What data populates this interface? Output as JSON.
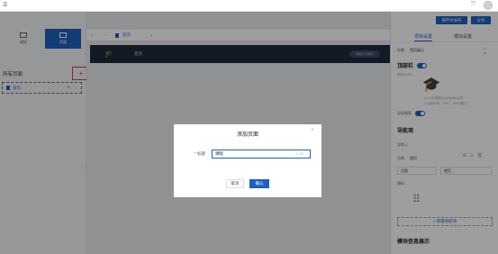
{
  "topbar": {
    "menu_icon": "menu-icon",
    "expand_icon": "fullscreen-icon",
    "avatar_icon": "user-avatar"
  },
  "left": {
    "modes": [
      {
        "label": "模块",
        "icon": "module-icon"
      },
      {
        "label": "页面",
        "icon": "page-icon"
      }
    ],
    "pages_title": "所有页面",
    "add_symbol": "+",
    "pages": [
      {
        "label": "首页"
      }
    ]
  },
  "editor": {
    "tab_label": "首页",
    "header_home": "首页",
    "search_placeholder": "请输入关键字"
  },
  "right": {
    "save_publish": "保存并发布",
    "publish": "分享",
    "tabs": [
      "项目设置",
      "模块设置"
    ],
    "title_label": "标题",
    "title_value": "首页展示",
    "title_count": "4 / 15",
    "topbar_section": "顶部栏",
    "logo_label": "网站LOGO",
    "logo_hint_1": "1.LOGO图片大小为6kb以内",
    "logo_hint_2": "2.支持PNG、JPG、JPEG格式",
    "full_search": "全局搜索",
    "nav_section": "导航项",
    "nav_item": "导航-1",
    "nav_name_label": "名称",
    "nav_name_value": "首页",
    "nav_type": "页面",
    "nav_target": "首页",
    "icon_label": "图标",
    "add_nav": "+ 新增导航项",
    "module_section": "模块信息展示"
  },
  "dialog": {
    "title": "添加页面",
    "required_mark": "*",
    "field_label": "标题",
    "field_value": "课程",
    "field_count": "2 / 15",
    "cancel": "取消",
    "confirm": "确认"
  },
  "colors": {
    "primary": "#1f5fbf",
    "header": "#1e2a3a",
    "highlight": "#e03b3b"
  }
}
